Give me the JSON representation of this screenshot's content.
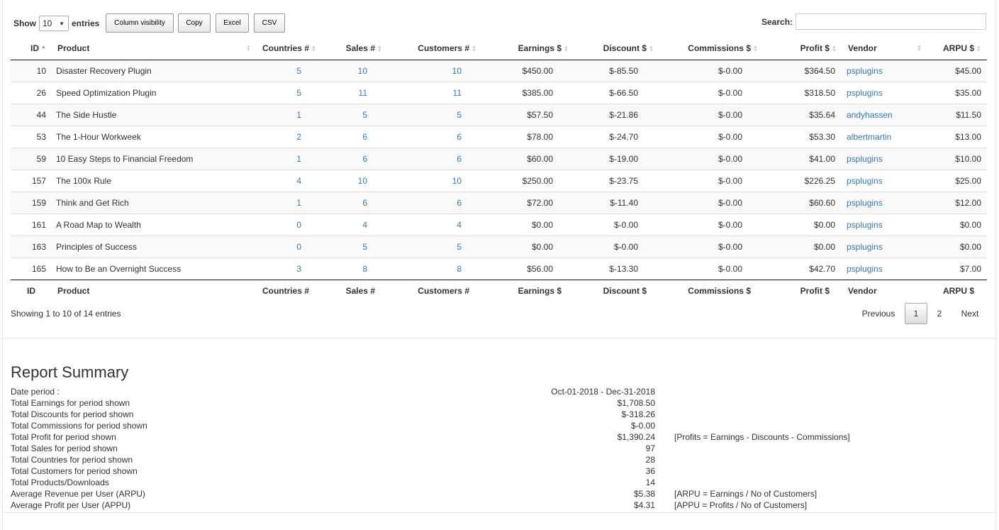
{
  "controls": {
    "show_label": "Show",
    "entries_value": "10",
    "entries_label": "entries",
    "buttons": [
      "Column visibility",
      "Copy",
      "Excel",
      "CSV"
    ],
    "search_label": "Search:",
    "search_value": ""
  },
  "table": {
    "columns": [
      "ID",
      "Product",
      "Countries #",
      "Sales #",
      "Customers #",
      "Earnings $",
      "Discount $",
      "Commissions $",
      "Profit $",
      "Vendor",
      "ARPU $"
    ],
    "rows": [
      {
        "id": "10",
        "product": "Disaster Recovery Plugin",
        "countries": "5",
        "sales": "10",
        "customers": "10",
        "earnings": "$450.00",
        "discount": "$-85.50",
        "commissions": "$-0.00",
        "profit": "$364.50",
        "vendor": "psplugins",
        "arpu": "$45.00"
      },
      {
        "id": "26",
        "product": "Speed Optimization Plugin",
        "countries": "5",
        "sales": "11",
        "customers": "11",
        "earnings": "$385.00",
        "discount": "$-66.50",
        "commissions": "$-0.00",
        "profit": "$318.50",
        "vendor": "psplugins",
        "arpu": "$35.00"
      },
      {
        "id": "44",
        "product": "The Side Hustle",
        "countries": "1",
        "sales": "5",
        "customers": "5",
        "earnings": "$57.50",
        "discount": "$-21.86",
        "commissions": "$-0.00",
        "profit": "$35.64",
        "vendor": "andyhassen",
        "arpu": "$11.50"
      },
      {
        "id": "53",
        "product": "The 1-Hour Workweek",
        "countries": "2",
        "sales": "6",
        "customers": "6",
        "earnings": "$78.00",
        "discount": "$-24.70",
        "commissions": "$-0.00",
        "profit": "$53.30",
        "vendor": "albertmartin",
        "arpu": "$13.00"
      },
      {
        "id": "59",
        "product": "10 Easy Steps to Financial Freedom",
        "countries": "1",
        "sales": "6",
        "customers": "6",
        "earnings": "$60.00",
        "discount": "$-19.00",
        "commissions": "$-0.00",
        "profit": "$41.00",
        "vendor": "psplugins",
        "arpu": "$10.00"
      },
      {
        "id": "157",
        "product": "The 100x Rule",
        "countries": "4",
        "sales": "10",
        "customers": "10",
        "earnings": "$250.00",
        "discount": "$-23.75",
        "commissions": "$-0.00",
        "profit": "$226.25",
        "vendor": "psplugins",
        "arpu": "$25.00"
      },
      {
        "id": "159",
        "product": "Think and Get Rich",
        "countries": "1",
        "sales": "6",
        "customers": "6",
        "earnings": "$72.00",
        "discount": "$-11.40",
        "commissions": "$-0.00",
        "profit": "$60.60",
        "vendor": "psplugins",
        "arpu": "$12.00"
      },
      {
        "id": "161",
        "product": "A Road Map to Wealth",
        "countries": "0",
        "sales": "4",
        "customers": "4",
        "earnings": "$0.00",
        "discount": "$-0.00",
        "commissions": "$-0.00",
        "profit": "$0.00",
        "vendor": "psplugins",
        "arpu": "$0.00"
      },
      {
        "id": "163",
        "product": "Principles of Success",
        "countries": "0",
        "sales": "5",
        "customers": "5",
        "earnings": "$0.00",
        "discount": "$-0.00",
        "commissions": "$-0.00",
        "profit": "$0.00",
        "vendor": "psplugins",
        "arpu": "$0.00"
      },
      {
        "id": "165",
        "product": "How to Be an Overnight Success",
        "countries": "3",
        "sales": "8",
        "customers": "8",
        "earnings": "$56.00",
        "discount": "$-13.30",
        "commissions": "$-0.00",
        "profit": "$42.70",
        "vendor": "psplugins",
        "arpu": "$7.00"
      }
    ]
  },
  "pagination": {
    "info": "Showing 1 to 10 of 14 entries",
    "previous": "Previous",
    "pages": [
      "1",
      "2"
    ],
    "current": "1",
    "next": "Next"
  },
  "summary": {
    "title": "Report Summary",
    "rows": [
      {
        "label": "Date period :",
        "value": "Oct-01-2018 - Dec-31-2018",
        "note": ""
      },
      {
        "label": "Total Earnings for period shown",
        "value": "$1,708.50",
        "note": ""
      },
      {
        "label": "Total Discounts for period shown",
        "value": "$-318.26",
        "note": ""
      },
      {
        "label": "Total Commissions for period shown",
        "value": "$-0.00",
        "note": ""
      },
      {
        "label": "Total Profit for period shown",
        "value": "$1,390.24",
        "note": "[Profits = Earnings - Discounts - Commissions]"
      },
      {
        "label": "Total Sales for period shown",
        "value": "97",
        "note": ""
      },
      {
        "label": "Total Countries for period shown",
        "value": "28",
        "note": ""
      },
      {
        "label": "Total Customers for period shown",
        "value": "36",
        "note": ""
      },
      {
        "label": "Total Products/Downloads",
        "value": "14",
        "note": ""
      },
      {
        "label": "Average Revenue per User (ARPU)",
        "value": "$5.38",
        "note": "[ARPU = Earnings / No of Customers]"
      },
      {
        "label": "Average Profit per User (APPU)",
        "value": "$4.31",
        "note": "[APPU = Profits / No of Customers]"
      }
    ]
  },
  "theme": {
    "link_color": "#337ab7",
    "stripe_color": "#f9f9f9",
    "sort_active_color": "#8090c0"
  }
}
